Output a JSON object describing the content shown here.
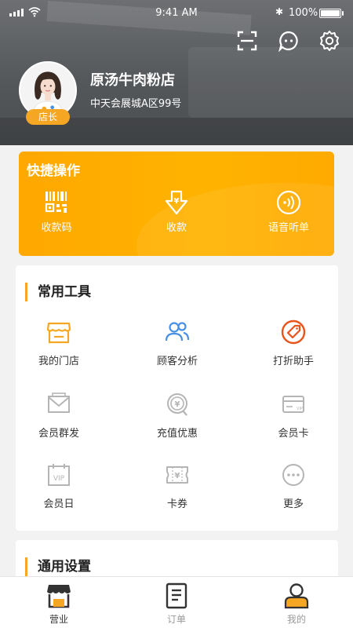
{
  "status_bar": {
    "time": "9:41 AM",
    "battery": "100%"
  },
  "header": {
    "store_name": "原汤牛肉粉店",
    "address": "中天会展城A区99号",
    "role_badge": "店长",
    "icons": [
      "scan-icon",
      "message-icon",
      "settings-icon"
    ]
  },
  "quick_actions": {
    "title": "快捷操作",
    "items": [
      {
        "label": "收款码",
        "icon": "qrcode-icon"
      },
      {
        "label": "收款",
        "icon": "receive-money-icon"
      },
      {
        "label": "语音听单",
        "icon": "voice-order-icon"
      }
    ]
  },
  "tools": {
    "title": "常用工具",
    "items": [
      {
        "label": "我的门店",
        "icon": "store-icon"
      },
      {
        "label": "顾客分析",
        "icon": "customers-icon"
      },
      {
        "label": "打折助手",
        "icon": "discount-tag-icon"
      },
      {
        "label": "会员群发",
        "icon": "mail-icon"
      },
      {
        "label": "充值优惠",
        "icon": "recharge-icon"
      },
      {
        "label": "会员卡",
        "icon": "member-card-icon"
      },
      {
        "label": "会员日",
        "icon": "vip-calendar-icon"
      },
      {
        "label": "卡券",
        "icon": "coupon-icon"
      },
      {
        "label": "更多",
        "icon": "more-icon"
      }
    ]
  },
  "settings": {
    "title": "通用设置"
  },
  "tabbar": {
    "items": [
      {
        "label": "营业",
        "icon": "shop-tab-icon",
        "active": true
      },
      {
        "label": "订单",
        "icon": "order-tab-icon",
        "active": false
      },
      {
        "label": "我的",
        "icon": "profile-tab-icon",
        "active": false
      }
    ]
  },
  "colors": {
    "accent": "#F5A623",
    "quick_bg": "#FFAD00",
    "icon_blue": "#4A90E2",
    "icon_red": "#E8541C",
    "icon_gray": "#B5B5B5"
  }
}
